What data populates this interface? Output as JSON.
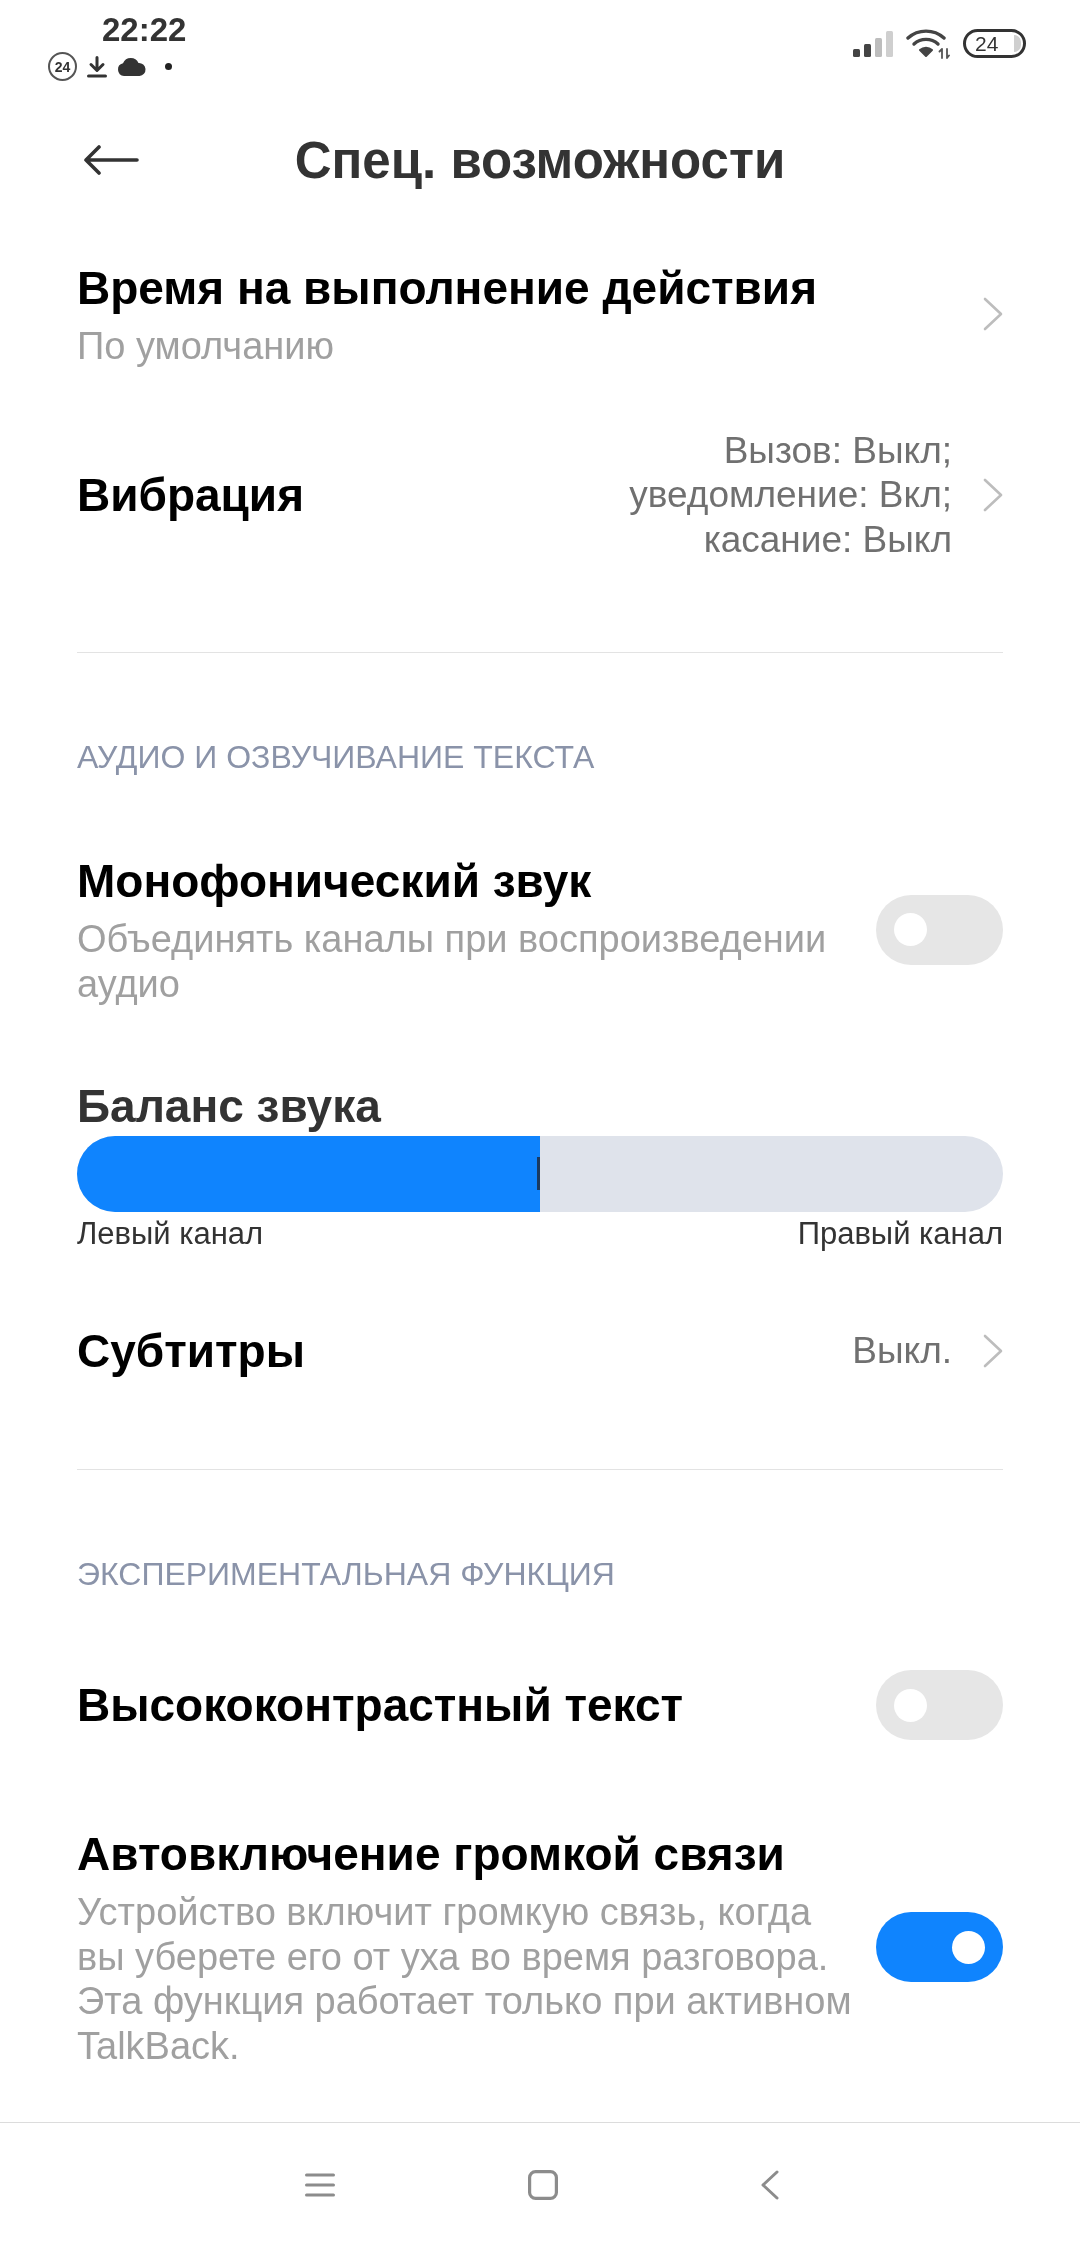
{
  "status_bar": {
    "time": "22:22",
    "date_badge": "24",
    "battery": "24"
  },
  "header": {
    "title": "Спец. возможности"
  },
  "items": [
    {
      "kind": "link",
      "title": "Время на выполнение действия",
      "summary": "По умолчанию"
    },
    {
      "kind": "link",
      "title": "Вибрация",
      "value_lines": [
        "Вызов: Выкл;",
        "уведомление: Вкл;",
        "касание: Выкл"
      ]
    },
    {
      "kind": "divider"
    },
    {
      "kind": "section",
      "title": "АУДИО И ОЗВУЧИВАНИЕ ТЕКСТА"
    },
    {
      "kind": "switch",
      "title": "Монофонический звук",
      "summary": "Объединять каналы при воспроизведении аудио",
      "on": false
    },
    {
      "kind": "balance",
      "title": "Баланс звука",
      "level": 0.5,
      "left_label": "Левый канал",
      "right_label": "Правый канал"
    },
    {
      "kind": "link",
      "title": "Субтитры",
      "value_lines": [
        "Выкл."
      ]
    },
    {
      "kind": "divider"
    },
    {
      "kind": "section",
      "title": "ЭКСПЕРИМЕНТАЛЬНАЯ ФУНКЦИЯ"
    },
    {
      "kind": "switch",
      "title": "Высококонтрастный текст",
      "on": false
    },
    {
      "kind": "switch",
      "title": "Автовключение громкой связи",
      "summary": "Устройство включит громкую связь, когда вы уберете его от уха во время разговора. Эта функция работает только при активном TalkBack.",
      "on": true
    }
  ]
}
